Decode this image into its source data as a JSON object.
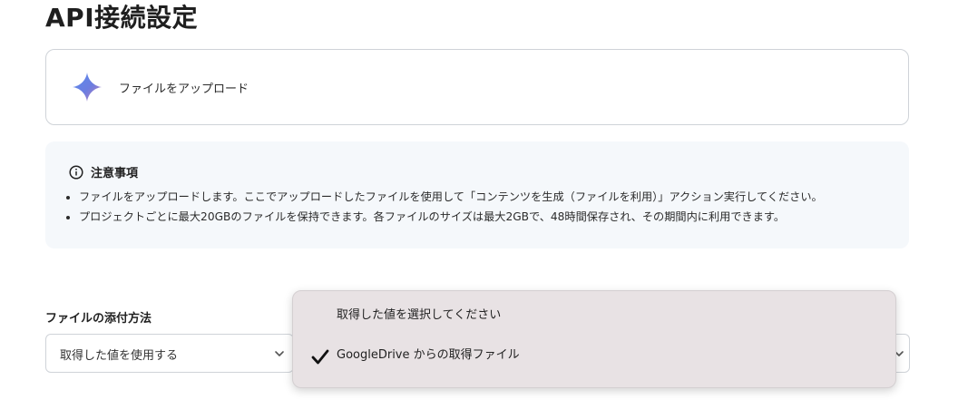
{
  "page": {
    "title": "API接続設定"
  },
  "action": {
    "label": "ファイルをアップロード",
    "icon": "gemini-star-icon"
  },
  "notice": {
    "title": "注意事項",
    "icon": "info-icon",
    "items": [
      "ファイルをアップロードします。ここでアップロードしたファイルを使用して「コンテンツを生成（ファイルを利用）」アクション実行してください。",
      "プロジェクトごとに最大20GBのファイルを保持できます。各ファイルのサイズは最大2GBで、48時間保存され、その期間内に利用できます。"
    ]
  },
  "attachment": {
    "label": "ファイルの添付方法",
    "method_value": "取得した値を使用する"
  },
  "dropdown": {
    "options": [
      {
        "label": "取得した値を選択してください",
        "selected": false
      },
      {
        "label": "GoogleDrive からの取得ファイル",
        "selected": true
      }
    ]
  },
  "colors": {
    "border": "#cfd3d8",
    "notice_bg": "#f5f8fb",
    "dropdown_bg": "#e8e2e4"
  }
}
